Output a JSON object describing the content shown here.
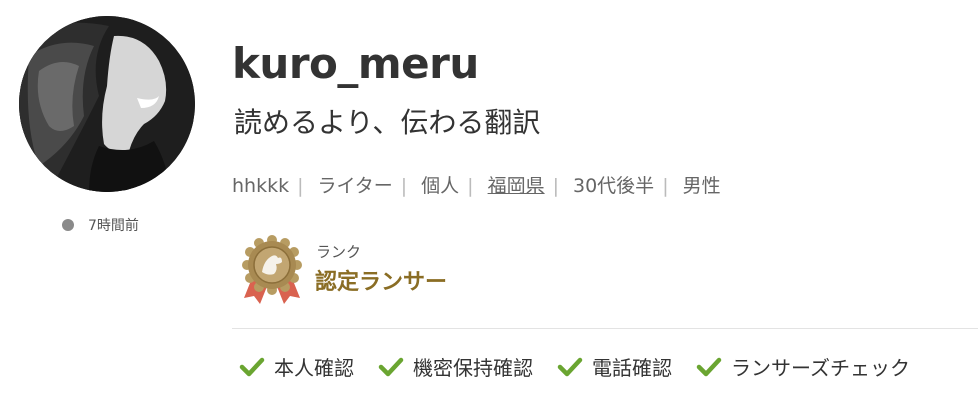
{
  "profile": {
    "username": "kuro_meru",
    "catchphrase": "読めるより、伝わる翻訳",
    "last_login": "7時間前",
    "attributes": [
      {
        "text": "hhkkk",
        "link": false
      },
      {
        "text": "ライター",
        "link": false
      },
      {
        "text": "個人",
        "link": false
      },
      {
        "text": "福岡県",
        "link": true
      },
      {
        "text": "30代後半",
        "link": false
      },
      {
        "text": "男性",
        "link": false
      }
    ],
    "status_color": "#8a8a8a"
  },
  "rank": {
    "label": "ランク",
    "value": "認定ランサー",
    "color": "#8a6d24"
  },
  "verifications": [
    {
      "label": "本人確認",
      "icon": "check-icon"
    },
    {
      "label": "機密保持確認",
      "icon": "check-icon"
    },
    {
      "label": "電話確認",
      "icon": "check-icon"
    },
    {
      "label": "ランサーズチェック",
      "icon": "check-icon"
    }
  ],
  "colors": {
    "check": "#6aa531",
    "text": "#333333",
    "muted": "#666666"
  }
}
